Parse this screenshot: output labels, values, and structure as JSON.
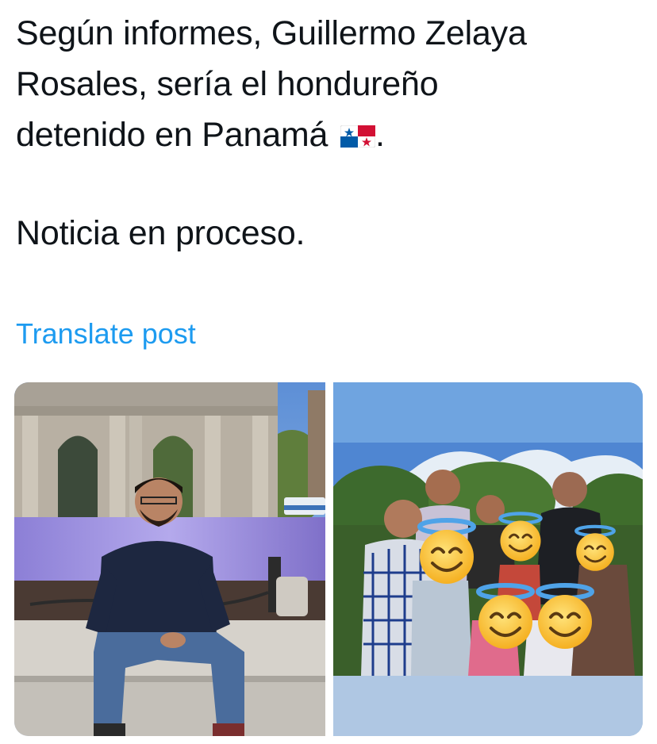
{
  "tweet": {
    "lines": [
      "Según informes, Guillermo Zelaya",
      "Rosales, sería el hondureño",
      "detenido en Panamá"
    ],
    "line3_suffix": ".",
    "line4": "Noticia en proceso.",
    "flag_icon": "panama-flag-emoji"
  },
  "translate_label": "Translate post",
  "colors": {
    "link": "#1d9bf0",
    "text": "#0f1419",
    "right_photo_bg": "#8fb7e3"
  },
  "media": {
    "left_icon": "photo-man-seated-at-monument",
    "right_icon": "photo-group-with-emoji-faces",
    "emoji_overlay": "smiling-face-with-halo-emoji"
  }
}
